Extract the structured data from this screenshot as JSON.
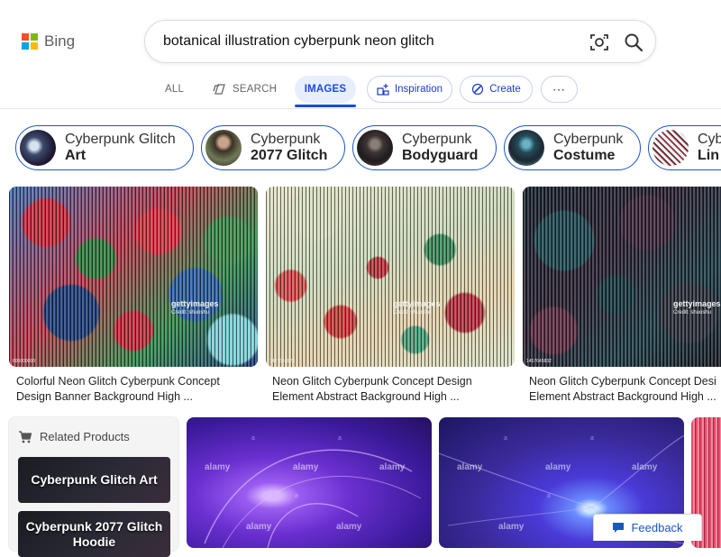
{
  "brand": {
    "name": "Bing",
    "logo_colors": [
      "#f25022",
      "#7fba00",
      "#00a4ef",
      "#ffb900"
    ]
  },
  "search": {
    "query": "botanical illustration cyberpunk neon glitch",
    "visual_search_icon": "camera-lens-icon",
    "search_icon": "magnifier-icon"
  },
  "nav": {
    "all": "ALL",
    "search": "SEARCH",
    "images": "IMAGES",
    "inspiration": "Inspiration",
    "create": "Create",
    "more": "⋯"
  },
  "related_searches": [
    {
      "line1": "Cyberpunk Glitch",
      "line2": "Art"
    },
    {
      "line1": "Cyberpunk",
      "line2": "2077 Glitch"
    },
    {
      "line1": "Cyberpunk",
      "line2": "Bodyguard"
    },
    {
      "line1": "Cyberpunk",
      "line2": "Costume"
    },
    {
      "line1": "Cyb",
      "line2": "Lin"
    }
  ],
  "results": [
    {
      "caption_line1": "Colorful Neon Glitch Cyberpunk Concept",
      "caption_line2": "Design Banner Background High ...",
      "watermark": "gettyimages",
      "credit": "Credit: shuoshu",
      "image_id": "000000000"
    },
    {
      "caption_line1": "Neon Glitch Cyberpunk Concept Design",
      "caption_line2": "Element Abstract Background High ...",
      "watermark": "gettyimages",
      "credit": "Credit: shuoshu",
      "image_id": "1457645823"
    },
    {
      "caption_line1": "Neon Glitch Cyberpunk Concept Desi",
      "caption_line2": "Element Abstract Background High ...",
      "watermark": "gettyimages",
      "credit": "Credit: shuoshu",
      "image_id": "1457645832"
    }
  ],
  "related_products": {
    "title": "Related Products",
    "items": [
      {
        "label": "Cyberpunk Glitch Art"
      },
      {
        "label": "Cyberpunk 2077 Glitch Hoodie"
      }
    ]
  },
  "bottom_watermark": "alamy",
  "bottom_watermark_a": "a",
  "feedback": {
    "label": "Feedback"
  },
  "colors": {
    "accent": "#174ae4",
    "chip_border": "#1a56c6",
    "images_tab_bg": "#e8eefb"
  }
}
